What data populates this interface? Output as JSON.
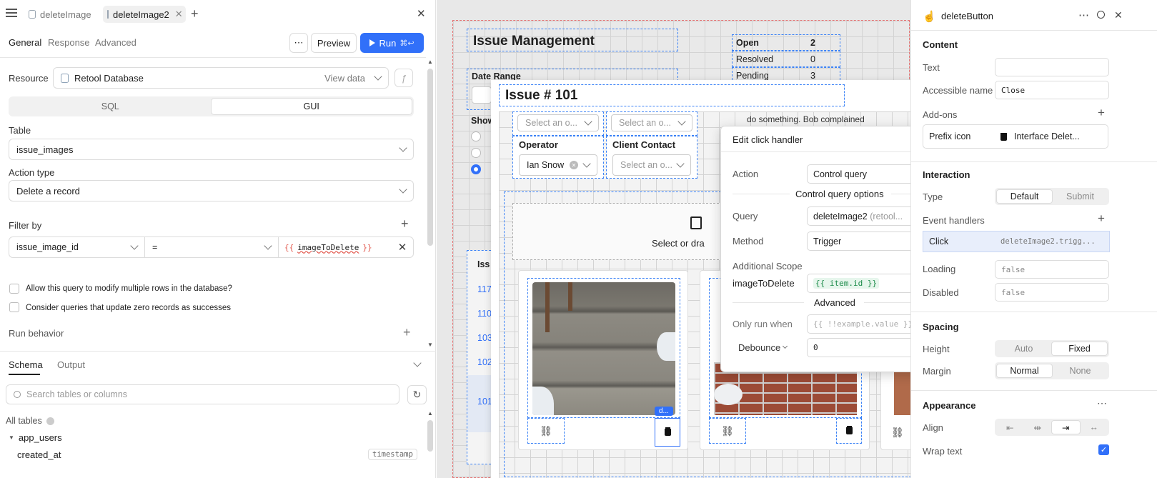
{
  "left": {
    "tabs": [
      {
        "label": "deleteImage"
      },
      {
        "label": "deleteImage2"
      }
    ],
    "subtabs": [
      "General",
      "Response",
      "Advanced"
    ],
    "preview_label": "Preview",
    "run_label": "Run",
    "run_shortcut": "⌘↩",
    "resource_label": "Resource",
    "resource_value": "Retool Database",
    "view_data": "View data",
    "mode": [
      "SQL",
      "GUI"
    ],
    "table_label": "Table",
    "table_value": "issue_images",
    "action_label": "Action type",
    "action_value": "Delete a record",
    "filter_label": "Filter by",
    "filter_col": "issue_image_id",
    "filter_op": "=",
    "filter_val_open": "{{",
    "filter_val_name": "imageToDelete",
    "filter_val_close": "}}",
    "opt1": "Allow this query to modify multiple rows in the database?",
    "opt2": "Consider queries that update zero records as successes",
    "run_behavior": "Run behavior",
    "schema_tab": "Schema",
    "output_tab": "Output",
    "search_placeholder": "Search tables or columns",
    "all_tables": "All tables",
    "table_app_users": "app_users",
    "col_created_at": "created_at",
    "col_type": "timestamp"
  },
  "canvas": {
    "title": "Issue Management",
    "stats": [
      {
        "k": "Open",
        "v": "2"
      },
      {
        "k": "Resolved",
        "v": "0"
      },
      {
        "k": "Pending",
        "v": "3"
      }
    ],
    "date_range": "Date Range",
    "show_label": "Show",
    "table_header": "Iss",
    "row_ids": [
      "117",
      "110",
      "103",
      "102",
      "101"
    ],
    "modal_title": "Issue # 101",
    "select_placeholder": "Select an o...",
    "operator_label": "Operator",
    "operator_value": "Ian Snow",
    "client_label": "Client Contact",
    "note_text": "do something. Bob complained",
    "upload_text": "Select or dra",
    "d_badge": "d..."
  },
  "popup": {
    "title": "Edit click handler",
    "action_label": "Action",
    "action_value": "Control query",
    "options_heading": "Control query options",
    "query_label": "Query",
    "query_value": "deleteImage2",
    "query_hint": "(retool...",
    "method_label": "Method",
    "method_value": "Trigger",
    "scope_label": "Additional Scope",
    "scope_key": "imageToDelete",
    "scope_value": "{{ item.id }}",
    "advanced_heading": "Advanced",
    "only_run_label": "Only run when",
    "only_run_placeholder": "{{ !!example.value }}",
    "debounce_label": "Debounce",
    "debounce_value": "0"
  },
  "right": {
    "component": "deleteButton",
    "content": "Content",
    "text_label": "Text",
    "text_value": "",
    "accessible_label": "Accessible name",
    "accessible_value": "Close",
    "addons": "Add-ons",
    "prefix_label": "Prefix icon",
    "prefix_value": "Interface Delet...",
    "interaction": "Interaction",
    "type_label": "Type",
    "type_opts": [
      "Default",
      "Submit"
    ],
    "handlers": "Event handlers",
    "handler_event": "Click",
    "handler_action": "deleteImage2.trigg...",
    "loading_label": "Loading",
    "loading_value": "false",
    "disabled_label": "Disabled",
    "disabled_value": "false",
    "spacing": "Spacing",
    "height_label": "Height",
    "height_opts": [
      "Auto",
      "Fixed"
    ],
    "margin_label": "Margin",
    "margin_opts": [
      "Normal",
      "None"
    ],
    "appearance": "Appearance",
    "align_label": "Align",
    "wrap_label": "Wrap text"
  },
  "colors": {
    "accent": "#3170f9",
    "dash": "#3b82f6"
  }
}
